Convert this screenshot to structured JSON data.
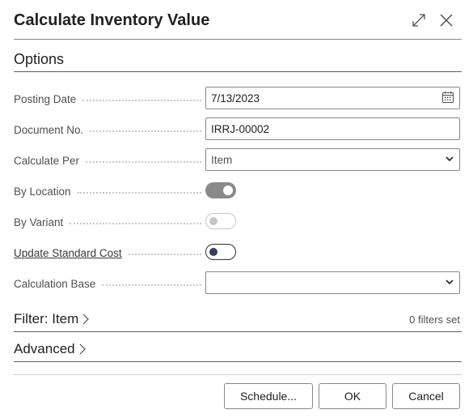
{
  "dialog": {
    "title": "Calculate Inventory Value"
  },
  "options": {
    "section_title": "Options",
    "posting_date": {
      "label": "Posting Date",
      "value": "7/13/2023"
    },
    "document_no": {
      "label": "Document No.",
      "value": "IRRJ-00002"
    },
    "calculate_per": {
      "label": "Calculate Per",
      "value": "Item"
    },
    "by_location": {
      "label": "By Location",
      "on": true
    },
    "by_variant": {
      "label": "By Variant",
      "on": false
    },
    "update_standard_cost": {
      "label": "Update Standard Cost",
      "on": false
    },
    "calculation_base": {
      "label": "Calculation Base",
      "value": ""
    }
  },
  "filter_item": {
    "title": "Filter: Item",
    "filters_set": "0 filters set"
  },
  "advanced": {
    "title": "Advanced"
  },
  "buttons": {
    "schedule": "Schedule...",
    "ok": "OK",
    "cancel": "Cancel"
  },
  "icons": {
    "expand": "expand-icon",
    "close": "close-icon",
    "calendar": "calendar-icon",
    "dropdown": "chevron-down-icon",
    "section_chevron": "chevron-right-icon"
  }
}
